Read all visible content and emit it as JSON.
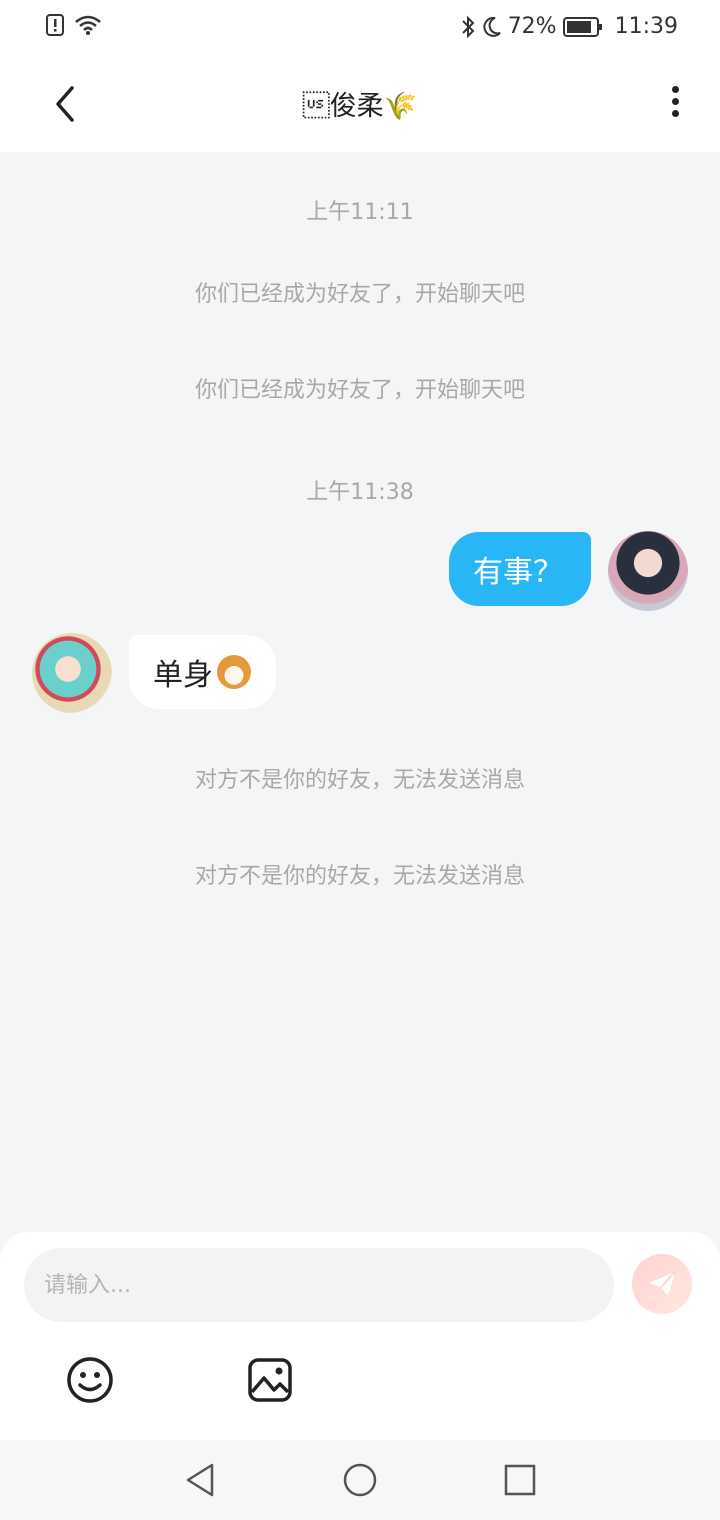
{
  "status": {
    "battery": "72%",
    "time": "11:39"
  },
  "header": {
    "title": "\u001f俊柔🌾"
  },
  "messages": {
    "time1": "上午11:11",
    "system1": "你们已经成为好友了，开始聊天吧",
    "system2": "你们已经成为好友了，开始聊天吧",
    "time2": "上午11:38",
    "outgoing": "有事？",
    "incoming": "单身",
    "notice1": "对方不是你的好友，无法发送消息",
    "notice2": "对方不是你的好友，无法发送消息"
  },
  "input": {
    "placeholder": "请输入..."
  },
  "icons": {
    "back": "back-arrow-icon",
    "more": "more-vertical-icon",
    "send": "paper-plane-icon",
    "emoji": "smiley-icon",
    "image": "image-icon",
    "incoming_emoji": "dog-emoji-icon"
  },
  "colors": {
    "outgoing_bubble": "#28b6f6",
    "chat_background": "#f4f5f7",
    "send_button": "#ffd2d2"
  }
}
